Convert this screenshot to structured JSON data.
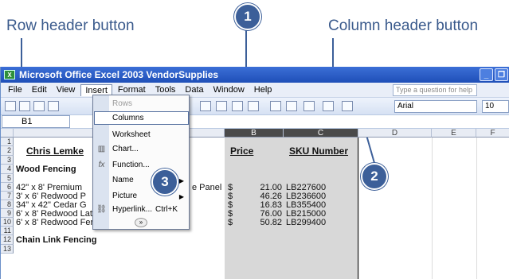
{
  "callouts": {
    "row_header_label": "Row header button",
    "column_header_label": "Column header button",
    "badge1": "1",
    "badge2": "2",
    "badge3": "3"
  },
  "window": {
    "title": "Microsoft Office Excel 2003  VendorSupplies",
    "question_placeholder": "Type a question for help",
    "font_name": "Arial",
    "font_size": "10"
  },
  "menubar": [
    "File",
    "Edit",
    "View",
    "Insert",
    "Format",
    "Tools",
    "Data",
    "Window",
    "Help"
  ],
  "namebox": "B1",
  "insert_menu": {
    "items": [
      {
        "label": "Rows",
        "disabled": true
      },
      {
        "label": "Columns",
        "highlighted": true
      },
      {
        "label": "Worksheet"
      },
      {
        "label": "Chart..."
      },
      {
        "label": "Function..."
      },
      {
        "label": "Name",
        "submenu": true
      },
      {
        "label": "Picture",
        "submenu": true
      },
      {
        "label": "Hyperlink...",
        "shortcut": "Ctrl+K"
      }
    ]
  },
  "columns": [
    "B",
    "C",
    "D",
    "E",
    "F"
  ],
  "rows": [
    "1",
    "2",
    "3",
    "4",
    "5",
    "6",
    "7",
    "8",
    "9",
    "10",
    "11",
    "12",
    "13"
  ],
  "cells": {
    "a2": "Chris Lemke",
    "a4": "Wood Fencing",
    "a6": "42\" x 8' Premium",
    "a6b": "e Panel",
    "a7": "3' x 6' Redwood P",
    "a8": "34\" x 42\" Cedar G",
    "a9": "6' x 8' Redwood Lattice Fence Panel",
    "a10": "6' x 8' Redwood Fence Panel",
    "a12": "Chain Link Fencing",
    "b2": "Price",
    "c2": "SKU Number",
    "prices": [
      "$",
      "$",
      "$",
      "$",
      "$"
    ],
    "values": [
      "21.00",
      "46.26",
      "16.83",
      "76.00",
      "50.82"
    ],
    "skus": [
      "LB227600",
      "LB236600",
      "LB355400",
      "LB215000",
      "LB299400"
    ]
  }
}
